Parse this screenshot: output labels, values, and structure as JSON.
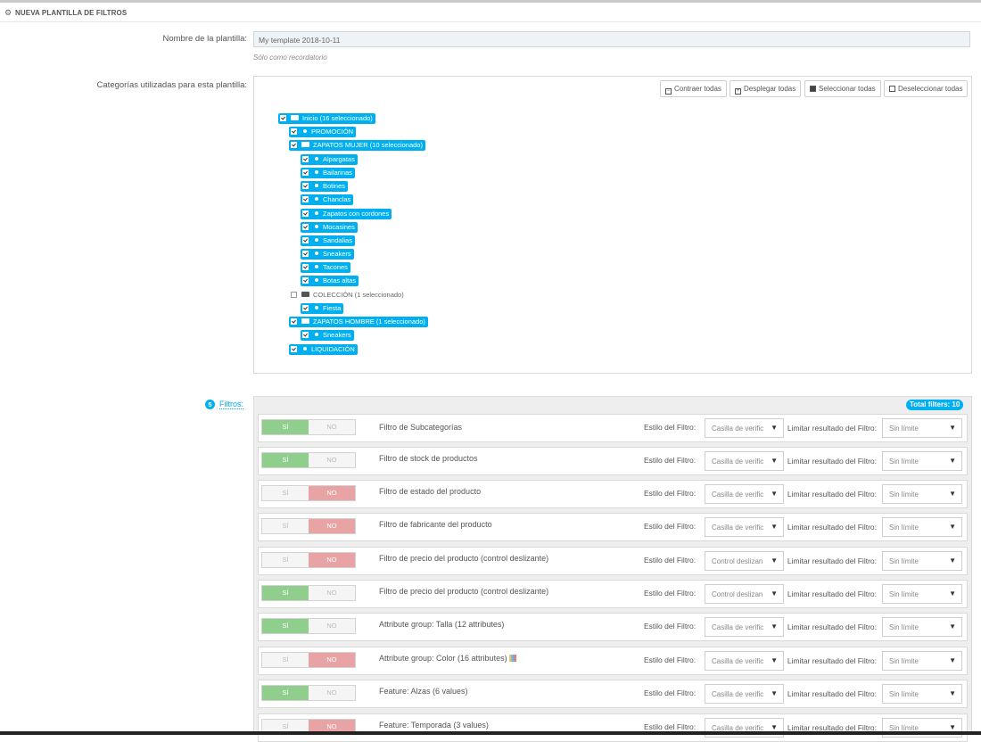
{
  "panel": {
    "title": "NUEVA PLANTILLA DE FILTROS",
    "icon": "gears-icon"
  },
  "name_field": {
    "label": "Nombre de la plantilla:",
    "value": "My template 2018-10-11",
    "hint": "Sólo como recordatorio"
  },
  "categories": {
    "label": "Categorías utilizadas para esta plantilla:",
    "buttons": [
      {
        "label": "Contraer todas",
        "icon": "collapse-icon"
      },
      {
        "label": "Desplegar todas",
        "icon": "expand-icon"
      },
      {
        "label": "Seleccionar todas",
        "icon": "checked-box-icon"
      },
      {
        "label": "Deseleccionar todas",
        "icon": "empty-box-icon"
      }
    ],
    "tree": [
      {
        "label": "Inicio (16 seleccionado)",
        "selected": true,
        "folder": true
      },
      {
        "label": "PROMOCIÓN",
        "selected": true,
        "folder": false
      },
      {
        "label": "ZAPATOS MUJER (10 seleccionado)",
        "selected": true,
        "folder": true
      },
      {
        "label": "Alpargatas",
        "selected": true,
        "folder": false
      },
      {
        "label": "Bailarinas",
        "selected": true,
        "folder": false
      },
      {
        "label": "Botines",
        "selected": true,
        "folder": false
      },
      {
        "label": "Chanclas",
        "selected": true,
        "folder": false
      },
      {
        "label": "Zapatos con cordones",
        "selected": true,
        "folder": false
      },
      {
        "label": "Mocasines",
        "selected": true,
        "folder": false
      },
      {
        "label": "Sandalias",
        "selected": true,
        "folder": false
      },
      {
        "label": "Sneakers",
        "selected": true,
        "folder": false
      },
      {
        "label": "Tacones",
        "selected": true,
        "folder": false
      },
      {
        "label": "Botas altas",
        "selected": true,
        "folder": false
      },
      {
        "label": "COLECCIÓN (1 seleccionado)",
        "selected": false,
        "folder": true
      },
      {
        "label": "Fiesta",
        "selected": true,
        "folder": false
      },
      {
        "label": "ZAPATOS HOMBRE (1 seleccionado)",
        "selected": true,
        "folder": true
      },
      {
        "label": "Sneakers",
        "selected": true,
        "folder": false
      },
      {
        "label": "LIQUIDACIÓN",
        "selected": true,
        "folder": false
      }
    ]
  },
  "filters": {
    "count": "5",
    "label": "Filtros:",
    "total": "Total filters: 10",
    "yes_label": "SÍ",
    "no_label": "NO",
    "style_label": "Estilo del Filtro:",
    "limit_label": "Limitar resultado del Filtro:",
    "items": [
      {
        "name": "Filtro de Subcategorías",
        "enabled": true,
        "style": "Casilla de verific",
        "limit": "Sin límite"
      },
      {
        "name": "Filtro de stock de productos",
        "enabled": true,
        "style": "Casilla de verific",
        "limit": "Sin límite"
      },
      {
        "name": "Filtro de estado del producto",
        "enabled": false,
        "style": "Casilla de verific",
        "limit": "Sin límite"
      },
      {
        "name": "Filtro de fabricante del producto",
        "enabled": false,
        "style": "Casilla de verific",
        "limit": "Sin límite"
      },
      {
        "name": "Filtro de precio del producto (control deslizante)",
        "enabled": false,
        "style": "Control deslizan",
        "limit": "Sin límite"
      },
      {
        "name": "Filtro de precio del producto (control deslizante)",
        "enabled": true,
        "style": "Control deslizan",
        "limit": "Sin límite"
      },
      {
        "name": "Attribute group: Talla (12 attributes)",
        "enabled": true,
        "style": "Casilla de verific",
        "limit": "Sin límite"
      },
      {
        "name": "Attribute group: Color (16 attributes)",
        "enabled": false,
        "style": "Casilla de verific",
        "limit": "Sin límite",
        "color_icon": true
      },
      {
        "name": "Feature: Alzas (6 values)",
        "enabled": true,
        "style": "Casilla de verific",
        "limit": "Sin límite"
      },
      {
        "name": "Feature: Temporada (3 values)",
        "enabled": false,
        "style": "Casilla de verific",
        "limit": "Sin límite"
      }
    ]
  }
}
